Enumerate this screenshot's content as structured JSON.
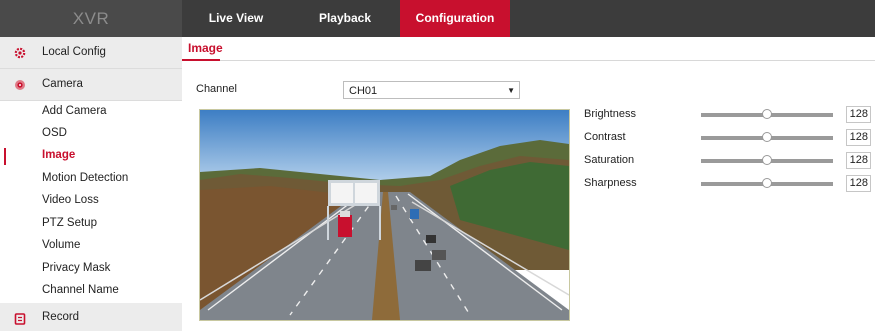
{
  "app": {
    "logo": "XVR"
  },
  "nav": {
    "tabs": [
      {
        "label": "Live View",
        "active": false
      },
      {
        "label": "Playback",
        "active": false
      },
      {
        "label": "Configuration",
        "active": true
      }
    ]
  },
  "sidebar": {
    "groups": [
      {
        "label": "Local Config",
        "icon": "gear-icon"
      },
      {
        "label": "Camera",
        "icon": "camera-icon"
      },
      {
        "label": "Record",
        "icon": "record-icon"
      }
    ],
    "camera_items": [
      {
        "label": "Add Camera"
      },
      {
        "label": "OSD"
      },
      {
        "label": "Image",
        "active": true
      },
      {
        "label": "Motion Detection"
      },
      {
        "label": "Video Loss"
      },
      {
        "label": "PTZ Setup"
      },
      {
        "label": "Volume"
      },
      {
        "label": "Privacy Mask"
      },
      {
        "label": "Channel Name"
      }
    ]
  },
  "main": {
    "title": "Image",
    "channel_label": "Channel",
    "channel_value": "CH01",
    "params": [
      {
        "label": "Brightness",
        "value": "128",
        "level": 0.5
      },
      {
        "label": "Contrast",
        "value": "128",
        "level": 0.5
      },
      {
        "label": "Saturation",
        "value": "128",
        "level": 0.5
      },
      {
        "label": "Sharpness",
        "value": "128",
        "level": 0.5
      }
    ]
  },
  "colors": {
    "accent": "#c8102e",
    "topbar": "#3c3c3c",
    "sidebar_group": "#ececec"
  }
}
